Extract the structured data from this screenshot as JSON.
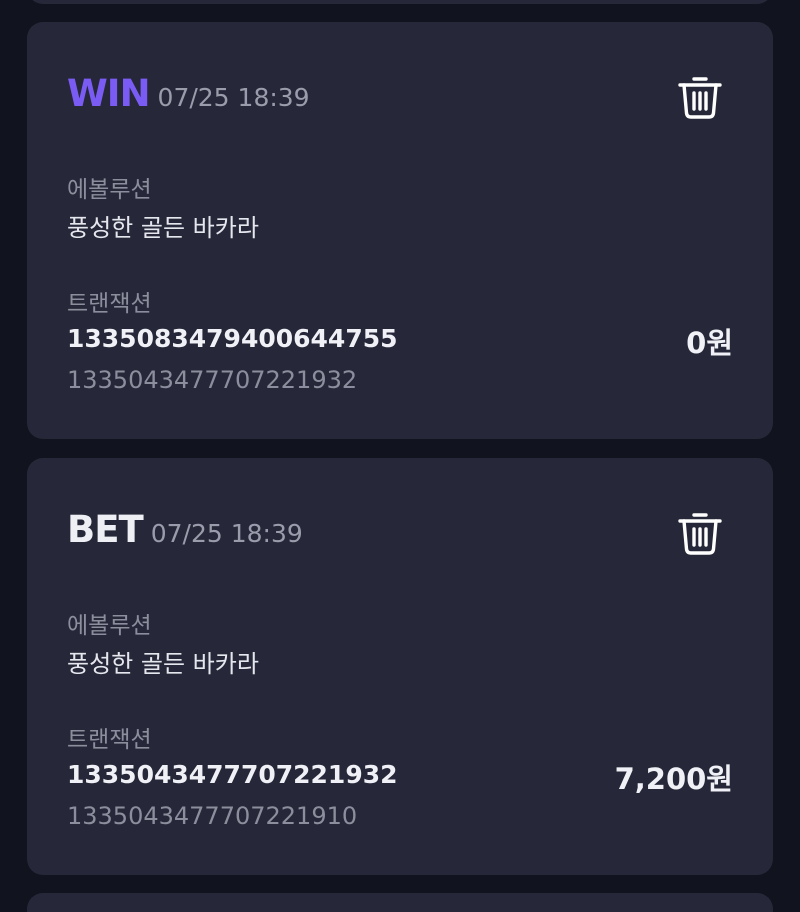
{
  "records": [
    {
      "type": "WIN",
      "time": "07/25 18:39",
      "provider_label": "에볼루션",
      "game": "풍성한 골든 바카라",
      "transaction_label": "트랜잭션",
      "transaction_id": "1335083479400644755",
      "reference_id": "1335043477707221932",
      "amount": "0원"
    },
    {
      "type": "BET",
      "time": "07/25 18:39",
      "provider_label": "에볼루션",
      "game": "풍성한 골든 바카라",
      "transaction_label": "트랜잭션",
      "transaction_id": "1335043477707221932",
      "reference_id": "1335043477707221910",
      "amount": "7,200원"
    }
  ],
  "icons": {
    "delete": "trash-icon"
  },
  "colors": {
    "background": "#11131e",
    "card": "#262839",
    "win_accent": "#7a5cf5",
    "bet_text": "#eeeff4",
    "muted_text": "#8c8e9d"
  }
}
